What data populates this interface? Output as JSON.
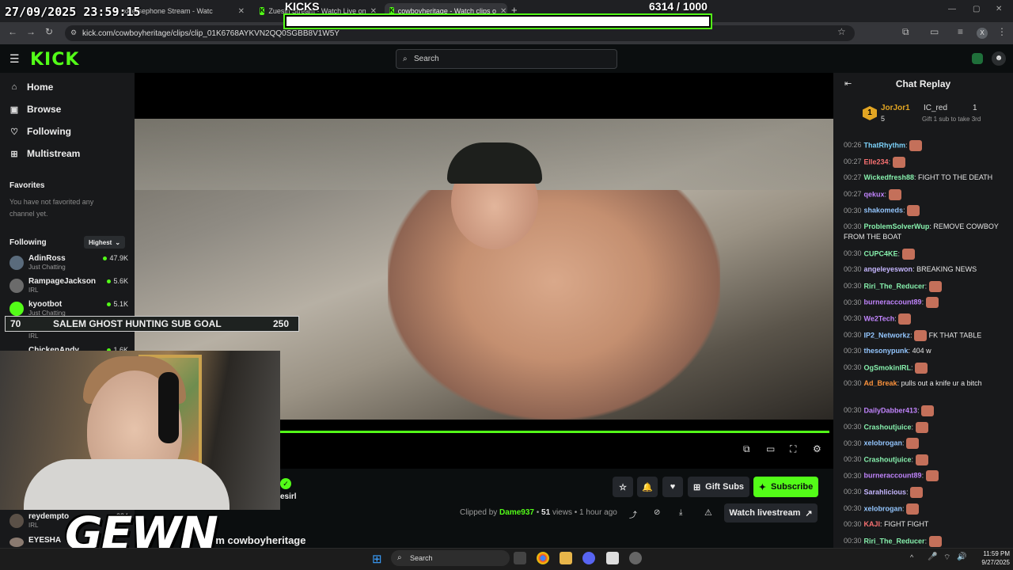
{
  "browser": {
    "tabs": [
      {
        "label": "xPersephone Stream - Watc"
      },
      {
        "label": "Zuesin Stream - Watch Live on"
      },
      {
        "label": "cowboyheritage - Watch clips o"
      }
    ],
    "url": "kick.com/cowboyheritage/clips/clip_01K6768AYKVN2QQ0SGBB8V1W5Y",
    "new_tab": "+"
  },
  "overlay": {
    "timestamp": "27/09/2025 23:59:15",
    "kicks_label": "KICKS",
    "kicks_count": "6314  / 1000",
    "kicks_progress": 1.0,
    "subgoal_start": "70",
    "subgoal_label": "SALEM GHOST HUNTING SUB GOAL",
    "subgoal_end": "250",
    "watermark": "GEWN"
  },
  "header": {
    "logo": "KICK",
    "search_placeholder": "Search"
  },
  "sidebar": {
    "nav": [
      {
        "label": "Home",
        "icon": "home-icon"
      },
      {
        "label": "Browse",
        "icon": "browse-icon"
      },
      {
        "label": "Following",
        "icon": "heart-icon"
      },
      {
        "label": "Multistream",
        "icon": "grid-icon"
      }
    ],
    "favorites_title": "Favorites",
    "favorites_empty": "You have not favorited any channel yet.",
    "following_title": "Following",
    "sort_label": "Highest",
    "channels": [
      {
        "name": "AdinRoss",
        "category": "Just Chatting",
        "viewers": "47.9K"
      },
      {
        "name": "RampageJackson",
        "category": "IRL",
        "viewers": "5.6K"
      },
      {
        "name": "kyootbot",
        "category": "Just Chatting",
        "viewers": "5.1K"
      },
      {
        "name": "",
        "category": "IRL",
        "viewers": ""
      },
      {
        "name": "ChickenAndy",
        "category": "",
        "viewers": "1.6K"
      },
      {
        "name": "reydempto",
        "category": "IRL",
        "viewers": "284"
      },
      {
        "name": "EYESHA",
        "category": "",
        "viewers": ""
      }
    ]
  },
  "video": {
    "progress": 1.0,
    "channel_partial": "esirl",
    "clip_title_partial": "from cowboyheritage"
  },
  "actions": {
    "gift_subs": "Gift Subs",
    "subscribe": "Subscribe",
    "watch_livestream": "Watch livestream"
  },
  "clipinfo": {
    "clipped_by_label": "Clipped by",
    "clipper": "Dame937",
    "views": "51",
    "views_label": "views",
    "age": "1 hour ago",
    "sep": "•"
  },
  "chat": {
    "title": "Chat Replay",
    "leader": {
      "rank": "1",
      "name": "JorJor1",
      "count": "5",
      "second": "IC_red",
      "second_count": "1",
      "hint": "Gift 1 sub to take 3rd"
    },
    "messages": [
      {
        "time": "00:26",
        "user": "ThatRhythm",
        "text": "",
        "color": "#7dd3fc",
        "emote": true
      },
      {
        "time": "00:27",
        "user": "Elle234",
        "text": "",
        "color": "#f87171",
        "emote": true
      },
      {
        "time": "00:27",
        "user": "Wickedfresh88",
        "text": "FIGHT TO THE DEATH",
        "color": "#86efac",
        "emote": false
      },
      {
        "time": "00:27",
        "user": "qekux",
        "text": "",
        "color": "#c084fc",
        "emote": true
      },
      {
        "time": "00:30",
        "user": "shakomeds",
        "text": "",
        "color": "#93c5fd",
        "emote": true
      },
      {
        "time": "00:30",
        "user": "ProblemSolverWup",
        "text": "REMOVE COWBOY FROM THE BOAT",
        "color": "#86efac",
        "emote": false
      },
      {
        "time": "00:30",
        "user": "CUPC4KE",
        "text": "",
        "color": "#86efac",
        "emote": true
      },
      {
        "time": "00:30",
        "user": "angeleyeswon",
        "text": "BREAKING NEWS",
        "color": "#c4b5fd",
        "emote": false
      },
      {
        "time": "00:30",
        "user": "Riri_The_Reducer",
        "text": "",
        "color": "#86efac",
        "emote": true
      },
      {
        "time": "00:30",
        "user": "burneraccount89",
        "text": "",
        "color": "#c084fc",
        "emote": true
      },
      {
        "time": "00:30",
        "user": "We2Tech",
        "text": "",
        "color": "#c084fc",
        "emote": true
      },
      {
        "time": "00:30",
        "user": "IP2_Networkz",
        "text": "FK THAT TABLE",
        "color": "#93c5fd",
        "emote": true
      },
      {
        "time": "00:30",
        "user": "thesonypunk",
        "text": "404 w",
        "color": "#93c5fd",
        "emote": false
      },
      {
        "time": "00:30",
        "user": "OgSmokinIRL",
        "text": "",
        "color": "#86efac",
        "emote": true
      },
      {
        "time": "00:30",
        "user": "Ad_Break",
        "text": "pulls out a knife ur a bitch",
        "color": "#fb923c",
        "emote": false
      },
      {
        "time": "00:30",
        "user": "DailyDabber413",
        "text": "",
        "color": "#c084fc",
        "emote": true
      },
      {
        "time": "00:30",
        "user": "Crashoutjuice",
        "text": "",
        "color": "#86efac",
        "emote": true
      },
      {
        "time": "00:30",
        "user": "xelobrogan",
        "text": "",
        "color": "#93c5fd",
        "emote": true
      },
      {
        "time": "00:30",
        "user": "Crashoutjuice",
        "text": "",
        "color": "#86efac",
        "emote": true
      },
      {
        "time": "00:30",
        "user": "burneraccount89",
        "text": "",
        "color": "#c084fc",
        "emote": true
      },
      {
        "time": "00:30",
        "user": "Sarahlicious",
        "text": "",
        "color": "#c4b5fd",
        "emote": true
      },
      {
        "time": "00:30",
        "user": "xelobrogan",
        "text": "",
        "color": "#93c5fd",
        "emote": true
      },
      {
        "time": "00:30",
        "user": "KAJI",
        "text": "FIGHT FIGHT",
        "color": "#f87171",
        "emote": false
      },
      {
        "time": "00:30",
        "user": "Riri_The_Reducer",
        "text": "",
        "color": "#86efac",
        "emote": true
      }
    ]
  },
  "taskbar": {
    "search": "Search",
    "time": "11:59 PM",
    "date": "9/27/2025"
  },
  "colors": {
    "accent": "#53fc18",
    "bg": "#0b0e0f",
    "panel": "#18191b"
  }
}
